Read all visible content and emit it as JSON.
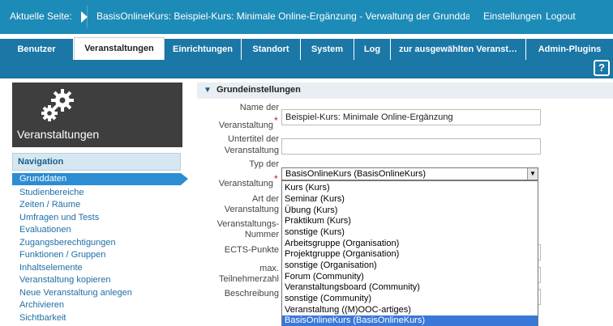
{
  "topbar": {
    "current_label": "Aktuelle Seite:",
    "current_title": "BasisOnlineKurs: Beispiel-Kurs: Minimale Online-Ergänzung - Verwaltung der Grunddaten",
    "settings_link": "Einstellungen",
    "logout_link": "Logout"
  },
  "tabs": [
    {
      "label": "Benutzer"
    },
    {
      "label": "Veranstaltungen"
    },
    {
      "label": "Einrichtungen"
    },
    {
      "label": "Standort"
    },
    {
      "label": "System"
    },
    {
      "label": "Log"
    },
    {
      "label": "zur ausgewählten Veranst…"
    },
    {
      "label": "Admin-Plugins"
    }
  ],
  "help": {
    "label": "?"
  },
  "sidebar": {
    "box_title": "Veranstaltungen",
    "nav_heading": "Navigation",
    "items": [
      {
        "label": "Grunddaten"
      },
      {
        "label": "Studienbereiche"
      },
      {
        "label": "Zeiten / Räume"
      },
      {
        "label": "Umfragen und Tests"
      },
      {
        "label": "Evaluationen"
      },
      {
        "label": "Zugangsberechtigungen"
      },
      {
        "label": "Funktionen / Gruppen"
      },
      {
        "label": "Inhaltselemente"
      },
      {
        "label": "Veranstaltung kopieren"
      },
      {
        "label": "Neue Veranstaltung anlegen"
      },
      {
        "label": "Archivieren"
      },
      {
        "label": "Sichtbarkeit"
      }
    ]
  },
  "form": {
    "section_title": "Grundeinstellungen",
    "name_label_1": "Name der",
    "name_label_2": "Veranstaltung",
    "name_value": "Beispiel-Kurs: Minimale Online-Ergänzung",
    "untertitel_label_1": "Untertitel der",
    "untertitel_label_2": "Veranstaltung",
    "typ_label_1": "Typ der",
    "typ_label_2": "Veranstaltung",
    "typ_selected": "BasisOnlineKurs (BasisOnlineKurs)",
    "art_label_1": "Art der",
    "art_label_2": "Veranstaltung",
    "nummer_label_1": "Veranstaltungs-",
    "nummer_label_2": "Nummer",
    "ects_label": "ECTS-Punkte",
    "teil_label_1": "max.",
    "teil_label_2": "Teilnehmerzahl",
    "beschr_label": "Beschreibung",
    "required_mark": "*",
    "options": [
      {
        "label": "Kurs (Kurs)"
      },
      {
        "label": "Seminar (Kurs)"
      },
      {
        "label": "Übung (Kurs)"
      },
      {
        "label": "Praktikum (Kurs)"
      },
      {
        "label": "sonstige (Kurs)"
      },
      {
        "label": "Arbeitsgruppe (Organisation)"
      },
      {
        "label": "Projektgruppe (Organisation)"
      },
      {
        "label": "sonstige (Organisation)"
      },
      {
        "label": "Forum (Community)"
      },
      {
        "label": "Veranstaltungsboard (Community)"
      },
      {
        "label": "sonstige (Community)"
      },
      {
        "label": "Veranstaltung ((M)OOC-artiges)"
      },
      {
        "label": "BasisOnlineKurs (BasisOnlineKurs)"
      }
    ]
  },
  "colors": {
    "primary": "#1d8bb7",
    "tab_bg": "#1a77a6",
    "nav_selected": "#2c8dd3",
    "option_selected": "#3a78d8",
    "required": "#dd1111"
  }
}
